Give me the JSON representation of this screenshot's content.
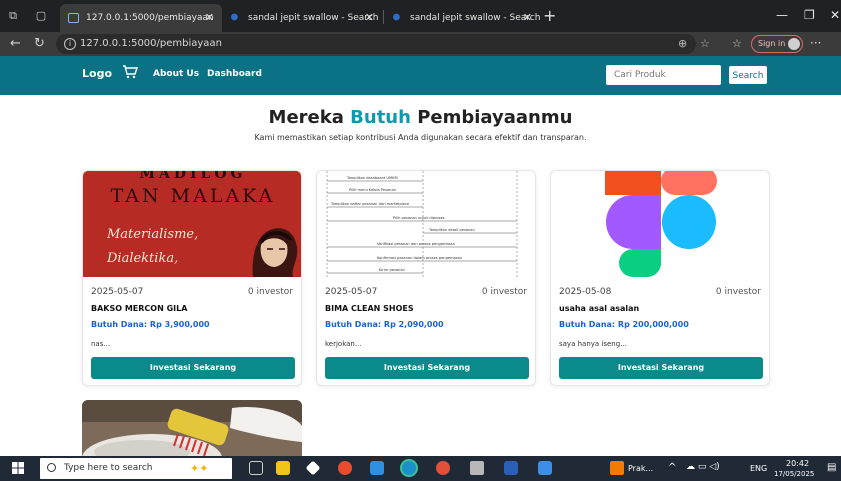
{
  "browser": {
    "tabs": [
      {
        "title": "127.0.0.1:5000/pembiayaan",
        "active": true
      },
      {
        "title": "sandal jepit swallow - Search",
        "active": false
      },
      {
        "title": "sandal jepit swallow - Search Ima",
        "active": false
      }
    ],
    "url": "127.0.0.1:5000/pembiayaan",
    "signin_label": "Sign in"
  },
  "navbar": {
    "logo": "Logo",
    "links": [
      "About Us",
      "Dashboard"
    ],
    "search_placeholder": "Cari Produk",
    "search_button": "Search"
  },
  "hero": {
    "title_part1": "Mereka",
    "title_accent": "Butuh",
    "title_part2": "Pembiayaanmu",
    "subtitle": "Kami memastikan setiap kontribusi Anda digunakan secara efektif dan transparan."
  },
  "cards": [
    {
      "date": "2025-05-07",
      "investors": "0 investor",
      "title": "BAKSO MERCON GILA",
      "fund": "Butuh Dana: Rp 3,900,000",
      "desc": "nas...",
      "button": "Investasi Sekarang",
      "image_text": {
        "top": "MADILOG",
        "author": "TAN MALAKA",
        "line1": "Materialisme,",
        "line2": "Dialektika,"
      }
    },
    {
      "date": "2025-05-07",
      "investors": "0 investor",
      "title": "BIMA CLEAN SHOES",
      "fund": "Butuh Dana: Rp 2,090,000",
      "desc": "kerjokan...",
      "button": "Investasi Sekarang",
      "image_text": {
        "labels": [
          "Tampilkan dashboard UMKM",
          "Pilih menu Kelola Pesanan",
          "Tampilkan daftar pesanan dari marketplace",
          "Pilih pesanan untuk diproses",
          "Tampilkan detail pesanan",
          "Verifikasi pesanan dan proses pengemasan",
          "Konfirmasi pesanan dalam proses pengemasan",
          "Kirim pesanan"
        ]
      }
    },
    {
      "date": "2025-05-08",
      "investors": "0 investor",
      "title": "usaha asal asalan",
      "fund": "Butuh Dana: Rp 200,000,000",
      "desc": "saya hanya iseng...",
      "button": "Investasi Sekarang"
    }
  ],
  "taskbar": {
    "search_placeholder": "Type here to search",
    "app_label": "Prak...",
    "lang": "ENG",
    "time": "20:42",
    "date": "17/05/2025"
  },
  "colors": {
    "brand": "#0b7286",
    "button": "#0b8a8c",
    "fund": "#1a62d6",
    "accent": "#0b9bb0"
  }
}
